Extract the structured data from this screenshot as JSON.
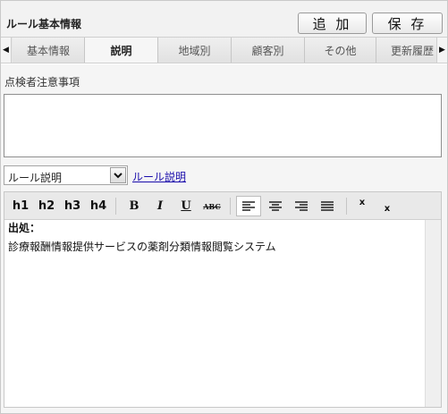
{
  "header": {
    "title": "ルール基本情報",
    "add_label": "追 加",
    "save_label": "保 存"
  },
  "tabs": [
    {
      "label": "基本情報",
      "active": false
    },
    {
      "label": "説明",
      "active": true
    },
    {
      "label": "地域別",
      "active": false
    },
    {
      "label": "顧客別",
      "active": false
    },
    {
      "label": "その他",
      "active": false
    },
    {
      "label": "更新履歴",
      "active": false
    }
  ],
  "form": {
    "notes_label": "点検者注意事項",
    "notes_value": "",
    "select_value": "ルール説明",
    "link_label": "ルール説明"
  },
  "editor": {
    "toolbar": {
      "h1": "h1",
      "h2": "h2",
      "h3": "h3",
      "h4": "h4",
      "bold": "B",
      "italic": "I",
      "underline": "U",
      "strike": "ABC",
      "superscript": "x",
      "subscript": "x"
    },
    "content": {
      "line1": "出処：",
      "line2": "診療報酬情報提供サービスの薬剤分類情報閲覧システム"
    }
  },
  "icons": {
    "tab_left": "triangle-left-icon",
    "tab_right": "triangle-right-icon",
    "select_arrow": "chevron-down-icon",
    "align_left": "align-left-icon",
    "align_center": "align-center-icon",
    "align_right": "align-right-icon",
    "align_justify": "align-justify-icon"
  }
}
